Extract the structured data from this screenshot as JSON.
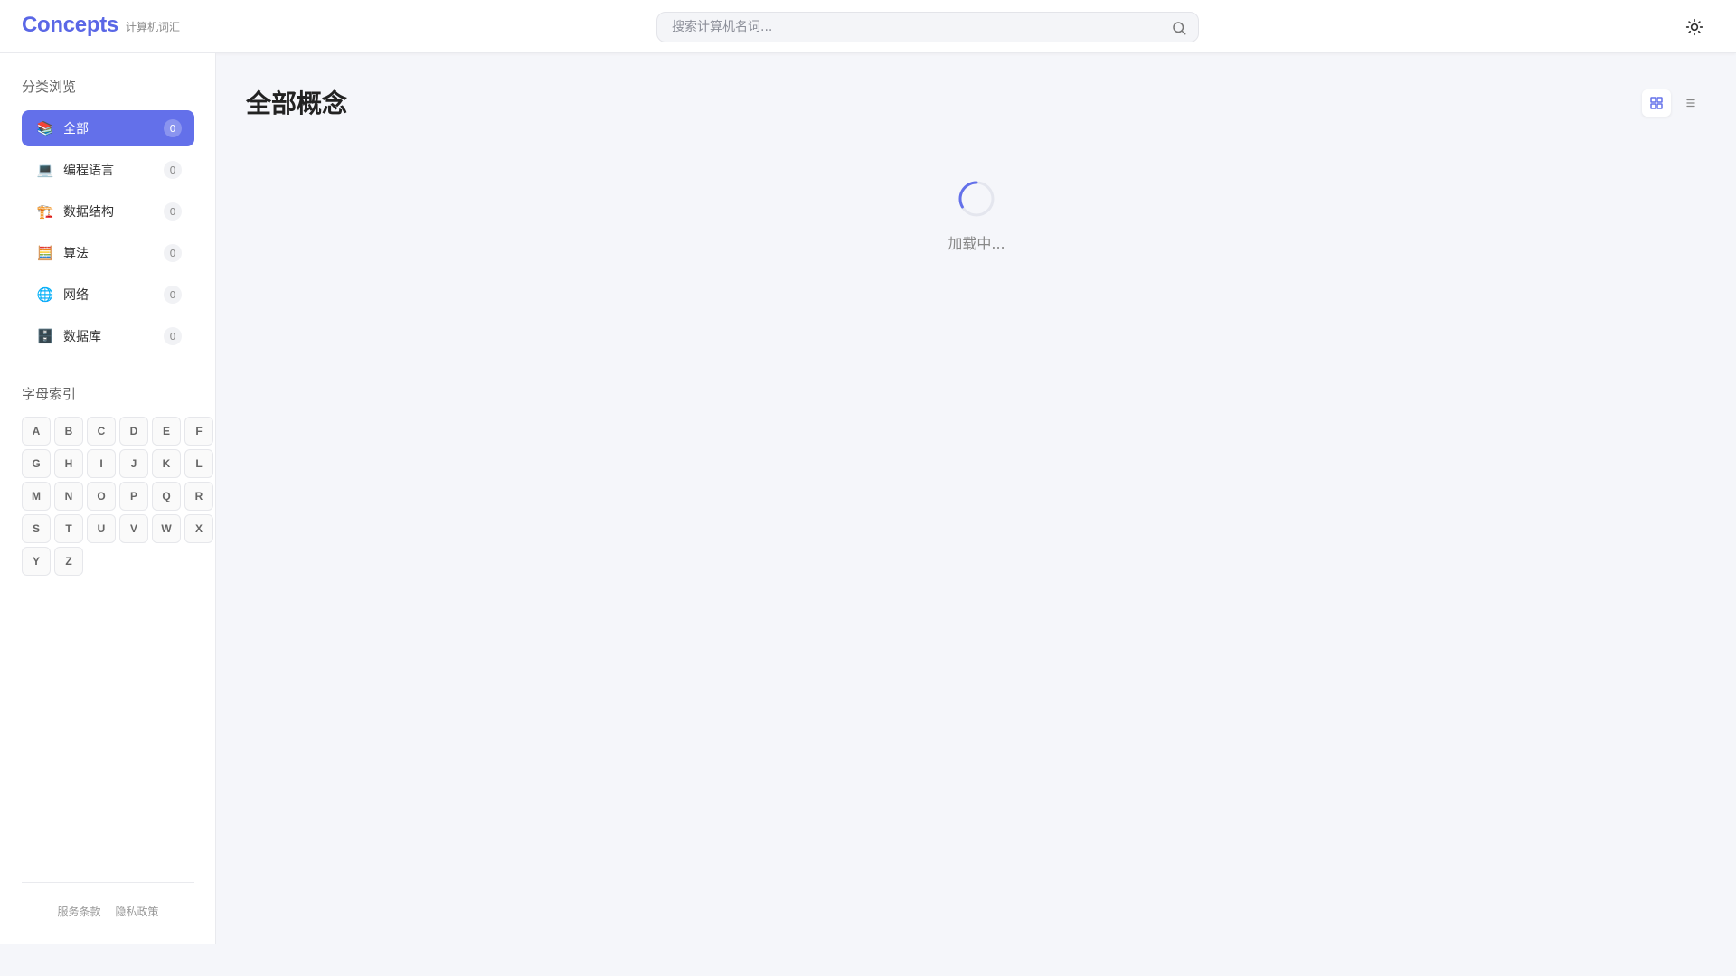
{
  "header": {
    "brand_name": "Concepts",
    "brand_subtitle": "计算机词汇",
    "search_placeholder": "搜索计算机名词...",
    "theme_toggle_icon": "sun-icon"
  },
  "sidebar": {
    "categories_title": "分类浏览",
    "categories": [
      {
        "emoji": "📚",
        "label": "全部",
        "count": "0",
        "active": true
      },
      {
        "emoji": "💻",
        "label": "编程语言",
        "count": "0",
        "active": false
      },
      {
        "emoji": "🏗️",
        "label": "数据结构",
        "count": "0",
        "active": false
      },
      {
        "emoji": "🧮",
        "label": "算法",
        "count": "0",
        "active": false
      },
      {
        "emoji": "🌐",
        "label": "网络",
        "count": "0",
        "active": false
      },
      {
        "emoji": "🗄️",
        "label": "数据库",
        "count": "0",
        "active": false
      }
    ],
    "letters_title": "字母索引",
    "letters": [
      "A",
      "B",
      "C",
      "D",
      "E",
      "F",
      "G",
      "H",
      "I",
      "J",
      "K",
      "L",
      "M",
      "N",
      "O",
      "P",
      "Q",
      "R",
      "S",
      "T",
      "U",
      "V",
      "W",
      "X",
      "Y",
      "Z"
    ],
    "footer": {
      "terms": "服务条款",
      "privacy": "隐私政策"
    }
  },
  "main": {
    "title": "全部概念",
    "view_modes": [
      {
        "icon": "grid-icon",
        "active": true
      },
      {
        "icon": "list-icon",
        "active": false
      }
    ],
    "loading_text": "加载中..."
  },
  "colors": {
    "accent": "#6370ea",
    "brand": "#5a67e6",
    "background": "#f5f6fa"
  }
}
